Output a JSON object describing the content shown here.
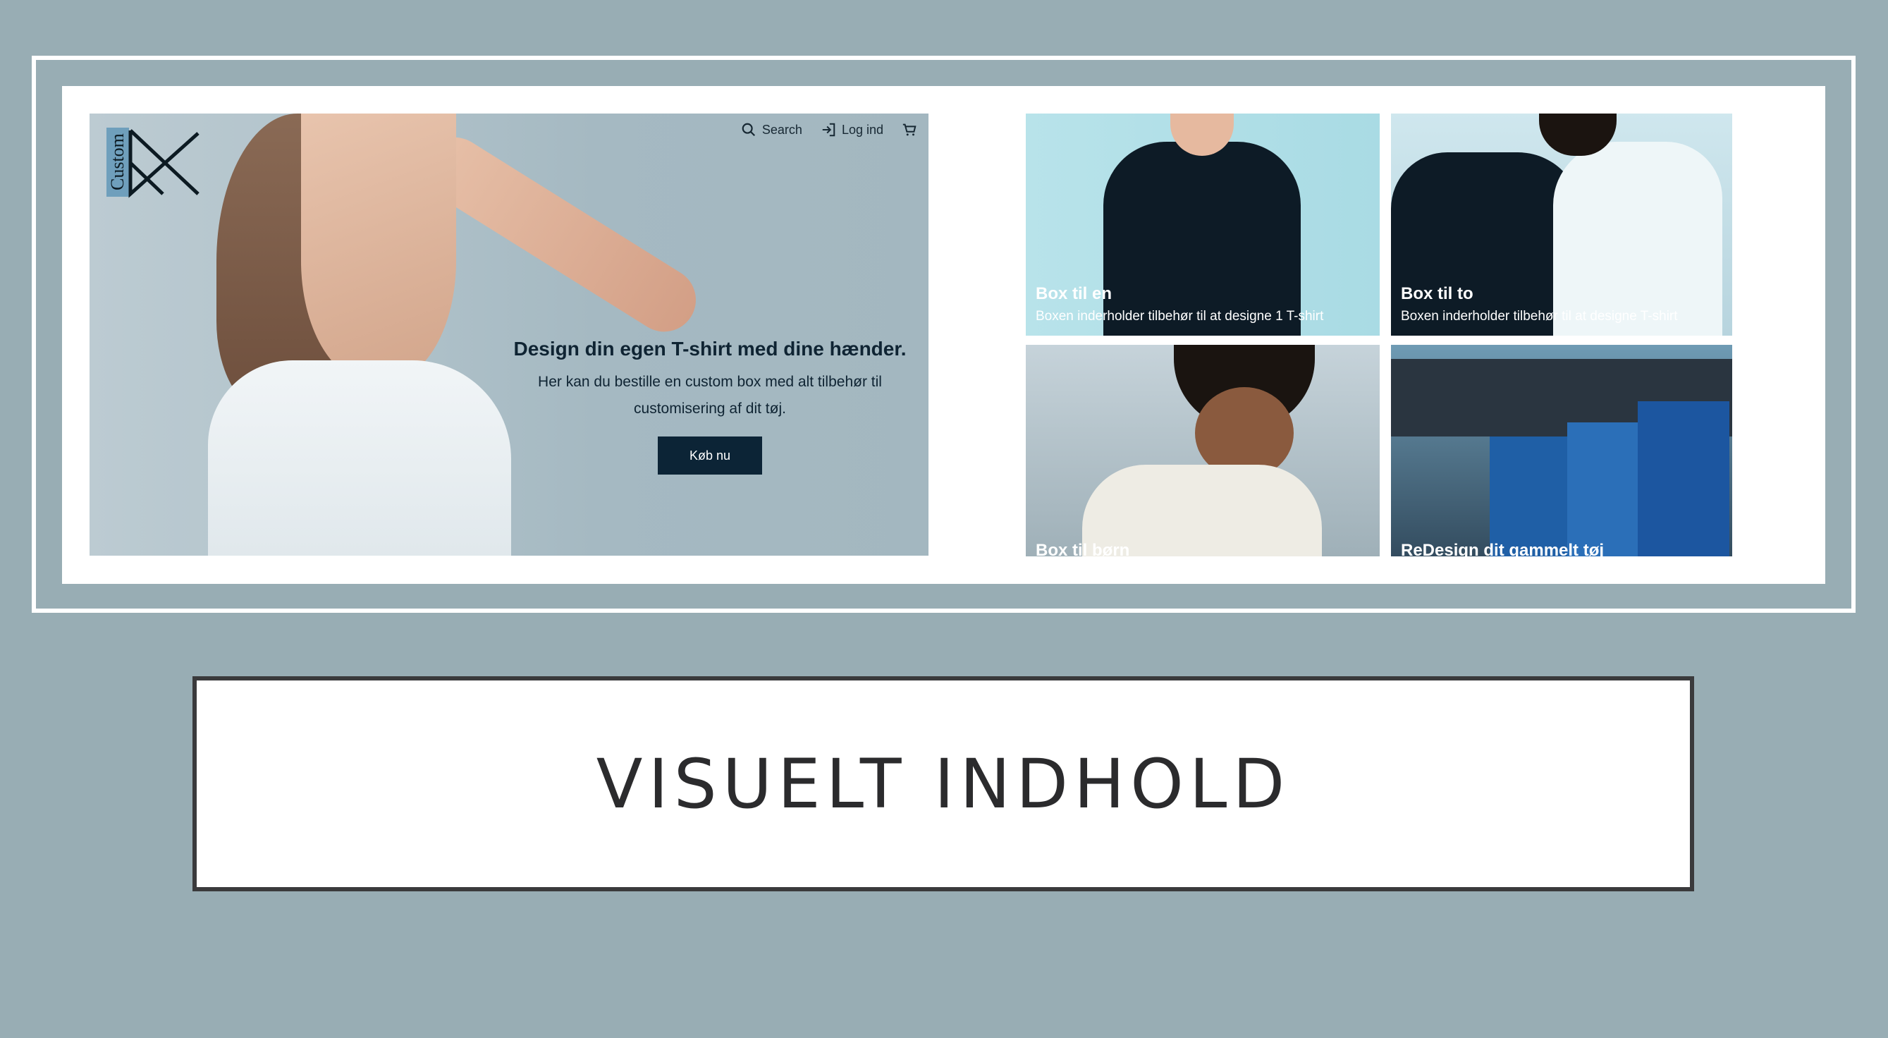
{
  "nav": {
    "search_label": "Search",
    "login_label": "Log ind"
  },
  "logo": {
    "word": "Custom"
  },
  "hero": {
    "title": "Design din egen T-shirt med dine hænder.",
    "subtitle_line1": "Her kan du bestille en custom box med alt tilbehør til",
    "subtitle_line2": "customisering af dit tøj.",
    "button_label": "Køb nu"
  },
  "products": [
    {
      "title": "Box til en",
      "description": "Boxen inderholder tilbehør til at designe 1 T-shirt"
    },
    {
      "title": "Box til to",
      "description": "Boxen inderholder tilbehør til at designe T-shirt"
    },
    {
      "title": "Box til børn",
      "description": ""
    },
    {
      "title": "ReDesign dit gammelt tøj",
      "description": ""
    }
  ],
  "caption": {
    "text": "VISUELT INDHOLD"
  },
  "colors": {
    "background": "#98adb4",
    "button": "#0c2436",
    "logo_accent": "#6f9fbc"
  },
  "icons": [
    "search-icon",
    "login-icon",
    "cart-icon"
  ]
}
